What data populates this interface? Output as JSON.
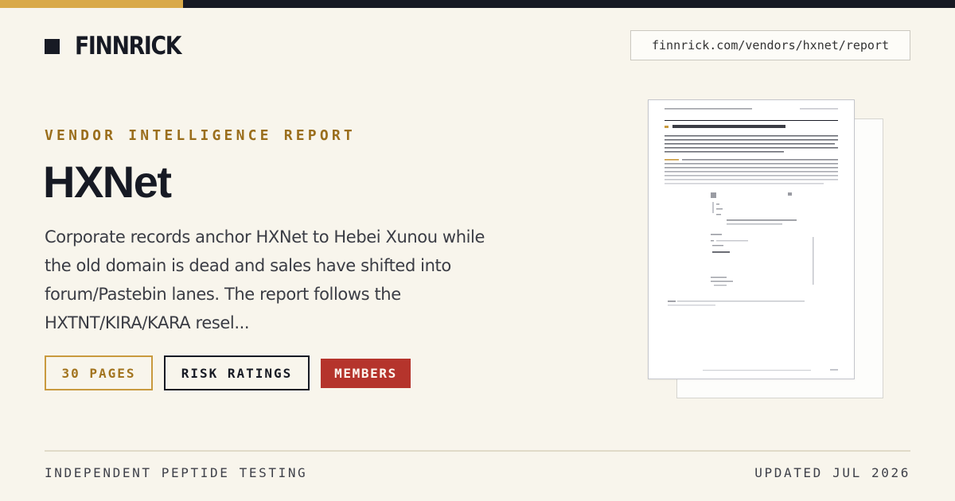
{
  "brand": {
    "name": "FINNRICK"
  },
  "url": "finnrick.com/vendors/hxnet/report",
  "eyebrow": "VENDOR INTELLIGENCE REPORT",
  "title": "HXNet",
  "description": "Corporate records anchor HXNet to Hebei Xunou while the old domain is dead and sales have shifted into forum/Pastebin lanes. The report follows the HXTNT/KIRA/KARA resel...",
  "badges": {
    "pages": "30 PAGES",
    "risk": "RISK RATINGS",
    "members": "MEMBERS"
  },
  "footer": {
    "left": "INDEPENDENT PEPTIDE TESTING",
    "right": "UPDATED JUL 2026"
  },
  "colors": {
    "background": "#f8f5ec",
    "ink": "#171a24",
    "gold": "#d9a949",
    "eyebrow": "#9a6e1c",
    "members_badge": "#b5342c"
  },
  "icons": {
    "brand_mark": "square-logo-mark"
  }
}
